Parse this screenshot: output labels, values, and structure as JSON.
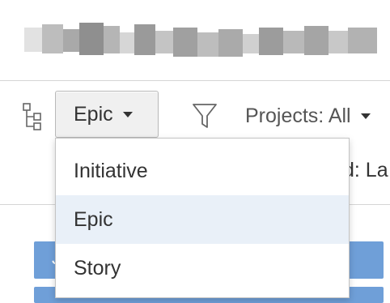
{
  "toolbar": {
    "hierarchy_icon": "tree-structure-icon",
    "issue_type_selected": "Epic",
    "filter_icon": "funnel-filter-icon",
    "projects_label": "Projects: All",
    "partially_hidden_text": "d: La"
  },
  "dropdown": {
    "options": [
      "Initiative",
      "Epic",
      "Story"
    ],
    "highlighted": "Epic"
  },
  "lane_peek_text": "J",
  "colors": {
    "accent_blue": "#6f9fd8",
    "menu_highlight": "#e9f0f8",
    "button_bg": "#f0f0f0"
  }
}
